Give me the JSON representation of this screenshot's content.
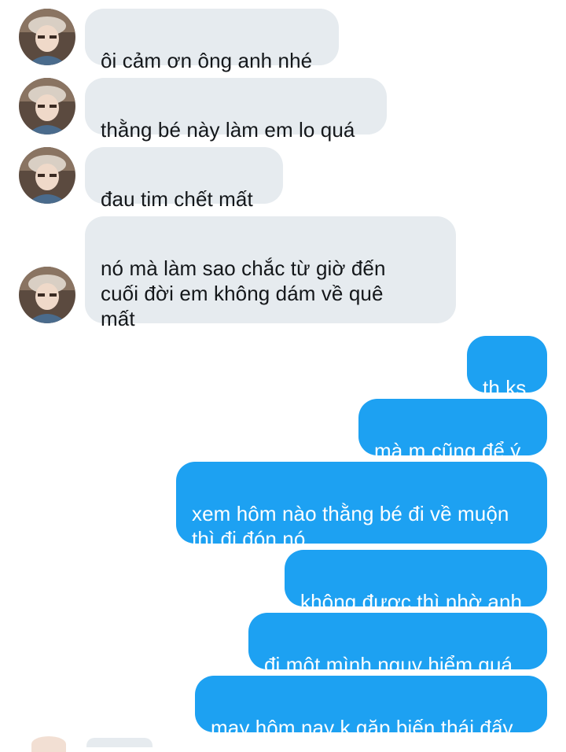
{
  "colors": {
    "incoming_bubble": "#e6ebef",
    "outgoing_bubble": "#1da1f2",
    "incoming_text": "#14171a",
    "outgoing_text": "#ffffff"
  },
  "contact": {
    "avatar_icon": "user-avatar-photo"
  },
  "messages": [
    {
      "direction": "in",
      "text": "ôi cảm ơn ông anh nhé"
    },
    {
      "direction": "in",
      "text": "thằng bé này làm em lo quá"
    },
    {
      "direction": "in",
      "text": "đau tim chết mất"
    },
    {
      "direction": "in",
      "text": "nó mà làm sao chắc từ giờ đến\ncuối đời em không dám về quê\nmất"
    },
    {
      "direction": "out",
      "text": "th ks"
    },
    {
      "direction": "out",
      "text": "mà m cũng để ý"
    },
    {
      "direction": "out",
      "text": "xem hôm nào thằng bé đi về muộn\nthì đi đón nó"
    },
    {
      "direction": "out",
      "text": "không được thì nhờ anh"
    },
    {
      "direction": "out",
      "text": "đi một mình nguy hiểm quá"
    },
    {
      "direction": "out",
      "text": "may hôm nay k gặp biến thái đấy"
    }
  ]
}
